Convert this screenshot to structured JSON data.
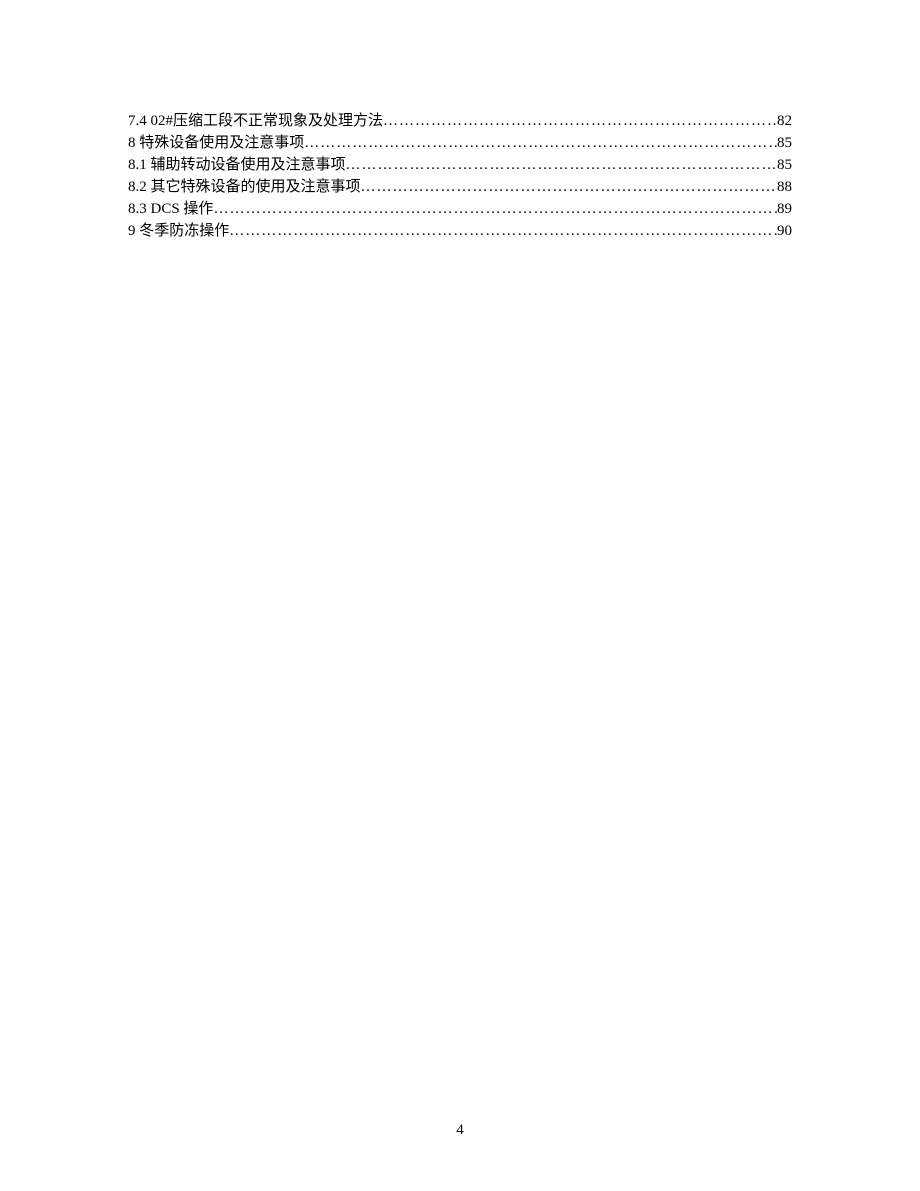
{
  "toc": [
    {
      "label": "7.4 02#压缩工段不正常现象及处理方法",
      "page": "82"
    },
    {
      "label": "8  特殊设备使用及注意事项",
      "page": "85"
    },
    {
      "label": "8.1  辅助转动设备使用及注意事项",
      "page": "85"
    },
    {
      "label": "8.2  其它特殊设备的使用及注意事项",
      "page": "88"
    },
    {
      "label": "8.3 DCS  操作",
      "page": "89"
    },
    {
      "label": "9  冬季防冻操作",
      "page": "90"
    }
  ],
  "pageNumber": "4"
}
